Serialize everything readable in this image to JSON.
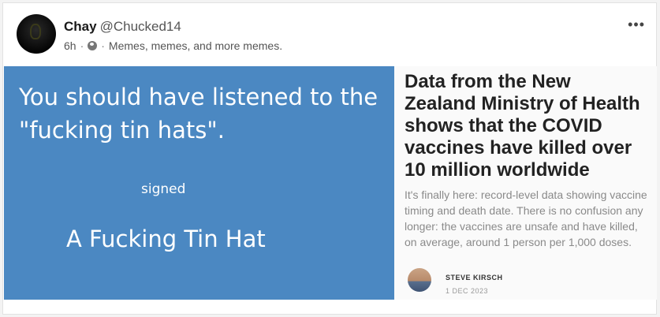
{
  "post": {
    "display_name": "Chay",
    "handle": "@Chucked14",
    "time_ago": "6h",
    "separator": "·",
    "visibility_icon": "globe-icon",
    "group": "Memes, memes, and more memes.",
    "more_label": "•••"
  },
  "meme": {
    "line1": "You should have listened to the \"fucking tin hats\".",
    "signed": "signed",
    "signature": "A Fucking Tin Hat",
    "background": "#4b88c2"
  },
  "article": {
    "title": "Data from the New Zealand Ministry of Health shows that the COVID vaccines have killed over 10 million worldwide",
    "summary": "It's finally here: record-level data showing vaccine timing and death date. There is no confusion any longer: the vaccines are unsafe and have killed, on average, around 1 person per 1,000 doses.",
    "author": "STEVE KIRSCH",
    "date": "1 DEC 2023"
  }
}
